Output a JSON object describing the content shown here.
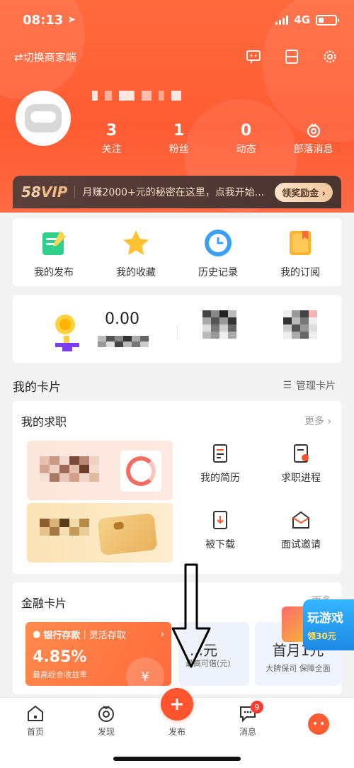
{
  "status": {
    "time": "08:13",
    "network": "4G"
  },
  "header": {
    "switch_label": "⇄切换商家端",
    "icons": [
      "customer-service-icon",
      "scan-icon",
      "settings-icon"
    ]
  },
  "profile": {
    "stats": [
      {
        "value": "3",
        "label": "关注"
      },
      {
        "value": "1",
        "label": "粉丝"
      },
      {
        "value": "0",
        "label": "动态"
      },
      {
        "value": "",
        "label": "部落消息"
      }
    ]
  },
  "vip": {
    "brand": "58",
    "brand_suffix": "VIP",
    "message": "月赚2000+元的秘密在这里，点我开始...",
    "button": "领奖励金 ›"
  },
  "quick_actions": [
    {
      "label": "我的发布",
      "icon": "edit-note-icon"
    },
    {
      "label": "我的收藏",
      "icon": "star-icon"
    },
    {
      "label": "历史记录",
      "icon": "clock-icon"
    },
    {
      "label": "我的订阅",
      "icon": "bookmark-icon"
    }
  ],
  "wallet": {
    "amount": "0.00"
  },
  "cards_section": {
    "title": "我的卡片",
    "manage": "管理卡片"
  },
  "job_card": {
    "title": "我的求职",
    "more": "更多 ›",
    "actions": [
      {
        "label": "我的简历",
        "icon": "resume-icon"
      },
      {
        "label": "求职进程",
        "icon": "progress-icon"
      },
      {
        "label": "被下载",
        "icon": "download-icon"
      },
      {
        "label": "面试邀请",
        "icon": "invite-icon"
      }
    ]
  },
  "finance_card": {
    "title": "金融卡片",
    "more": "更多",
    "bank": {
      "name": "银行存款",
      "type": "灵活存取",
      "rate": "4.85%",
      "sub": "最高综合收益率"
    },
    "loan": {
      "big": "...元",
      "sub": "最高可借(元)"
    },
    "insurance": {
      "big": "首月1元",
      "sub": "大牌保司 保障全面"
    }
  },
  "game_popup": {
    "line1": "玩游戏",
    "line2": "领30元"
  },
  "tabbar": {
    "tabs": [
      {
        "label": "首页",
        "icon": "home-icon"
      },
      {
        "label": "发现",
        "icon": "discover-icon"
      },
      {
        "label": "发布",
        "icon": "plus-icon"
      },
      {
        "label": "消息",
        "icon": "message-icon",
        "badge": "9"
      },
      {
        "label": "",
        "icon": "me-avatar-icon"
      }
    ]
  },
  "colors": {
    "brand": "#ff552e",
    "vip_bg": "#4e3632",
    "vip_gold": "#f3cfa6"
  }
}
